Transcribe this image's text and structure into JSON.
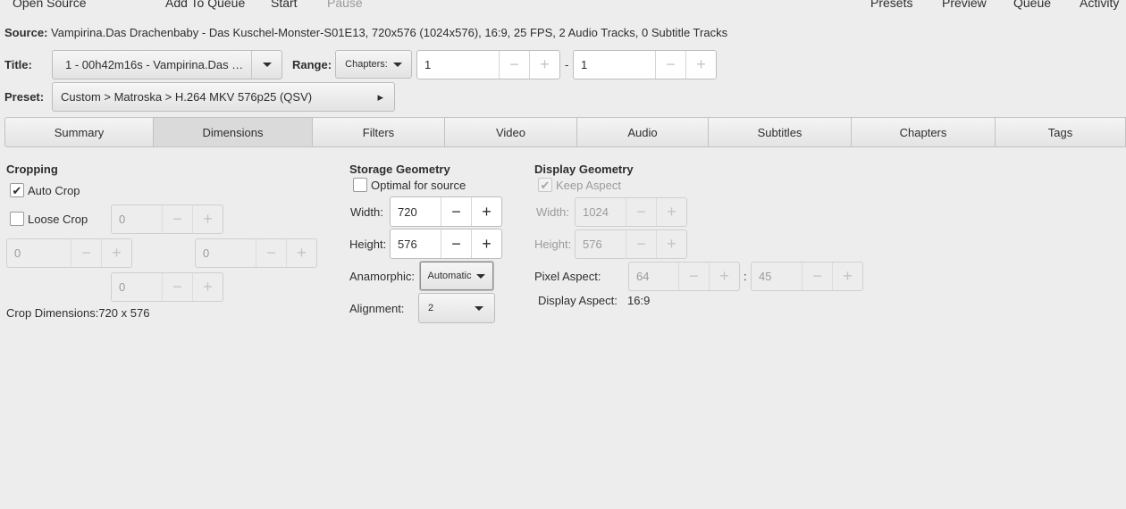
{
  "toolbar": {
    "open_source": "Open Source",
    "add_to_queue": "Add To Queue",
    "start": "Start",
    "pause": "Pause",
    "presets": "Presets",
    "preview": "Preview",
    "queue": "Queue",
    "activity": "Activity"
  },
  "source": {
    "label": "Source:",
    "value": "Vampirina.Das Drachenbaby - Das Kuschel-Monster-S01E13, 720x576 (1024x576), 16:9, 25 FPS, 2 Audio Tracks, 0 Subtitle Tracks"
  },
  "title_row": {
    "label": "Title:",
    "value": "1 - 00h42m16s - Vampirina.Das …",
    "range_label": "Range:",
    "range_mode": "Chapters:",
    "range_start": "1",
    "range_sep": "-",
    "range_end": "1"
  },
  "preset": {
    "label": "Preset:",
    "value": "Custom > Matroska > H.264 MKV 576p25 (QSV)"
  },
  "tabs": [
    {
      "label": "Summary"
    },
    {
      "label": "Dimensions",
      "active": true
    },
    {
      "label": "Filters"
    },
    {
      "label": "Video"
    },
    {
      "label": "Audio"
    },
    {
      "label": "Subtitles"
    },
    {
      "label": "Chapters"
    },
    {
      "label": "Tags"
    }
  ],
  "cropping": {
    "heading": "Cropping",
    "auto_crop": "Auto Crop",
    "auto_crop_checked": true,
    "loose_crop": "Loose Crop",
    "loose_crop_checked": false,
    "top": "0",
    "left": "0",
    "right": "0",
    "bottom": "0",
    "dimensions_label": "Crop Dimensions:",
    "dimensions_value": "720 x 576"
  },
  "storage": {
    "heading": "Storage Geometry",
    "optimal": "Optimal for source",
    "optimal_checked": false,
    "width_label": "Width:",
    "width": "720",
    "height_label": "Height:",
    "height": "576",
    "anamorphic_label": "Anamorphic:",
    "anamorphic": "Automatic",
    "alignment_label": "Alignment:",
    "alignment": "2"
  },
  "display": {
    "heading": "Display Geometry",
    "keep_aspect": "Keep Aspect",
    "keep_aspect_checked": true,
    "width_label": "Width:",
    "width": "1024",
    "height_label": "Height:",
    "height": "576",
    "pixel_aspect_label": "Pixel Aspect:",
    "pixel_aspect_x": "64",
    "pixel_aspect_sep": ":",
    "pixel_aspect_y": "45",
    "display_aspect_label": "Display Aspect:",
    "display_aspect": "16:9"
  },
  "icons": {
    "minus": "−",
    "plus": "+",
    "check": "✔",
    "triangle_right": "▸"
  }
}
